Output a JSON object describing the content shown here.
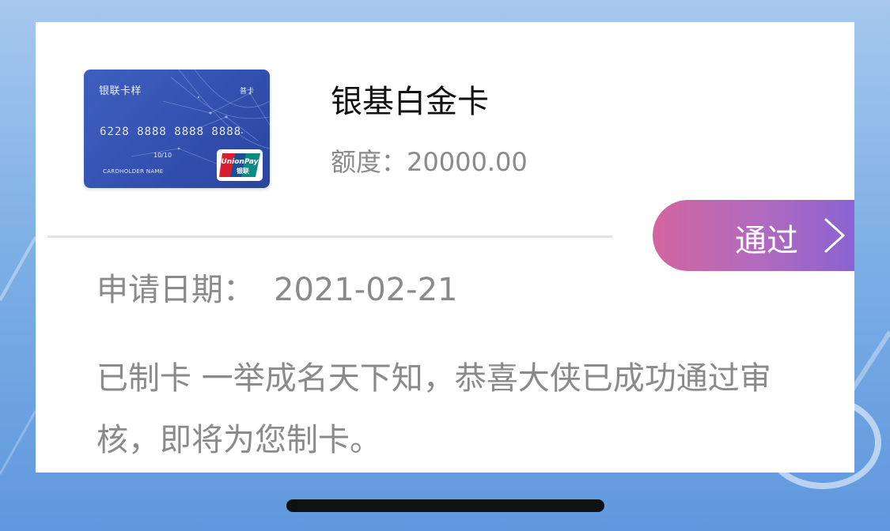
{
  "card_image": {
    "brand_text": "银联卡样",
    "card_type_text": "普卡",
    "card_number": "6228 8888 8888 8888",
    "expiry": "10/10",
    "holder_text": "CARDHOLDER NAME",
    "logo_top": "UnionPay",
    "logo_bottom": "银联",
    "logo_colors": [
      "#d7202f",
      "#1b4f9c",
      "#0b8a84"
    ]
  },
  "card": {
    "name": "银基白金卡",
    "limit_label": "额度：",
    "limit_value": "20000.00"
  },
  "status_button": {
    "label": "通过",
    "icon": "chevron-right-icon",
    "gradient": [
      "#d365a0",
      "#8a62d2"
    ]
  },
  "application": {
    "date_label": "申请日期：",
    "date_value": "2021-02-21",
    "message": "已制卡 一举成名天下知，恭喜大侠已成功通过审核，即将为您制卡。"
  }
}
